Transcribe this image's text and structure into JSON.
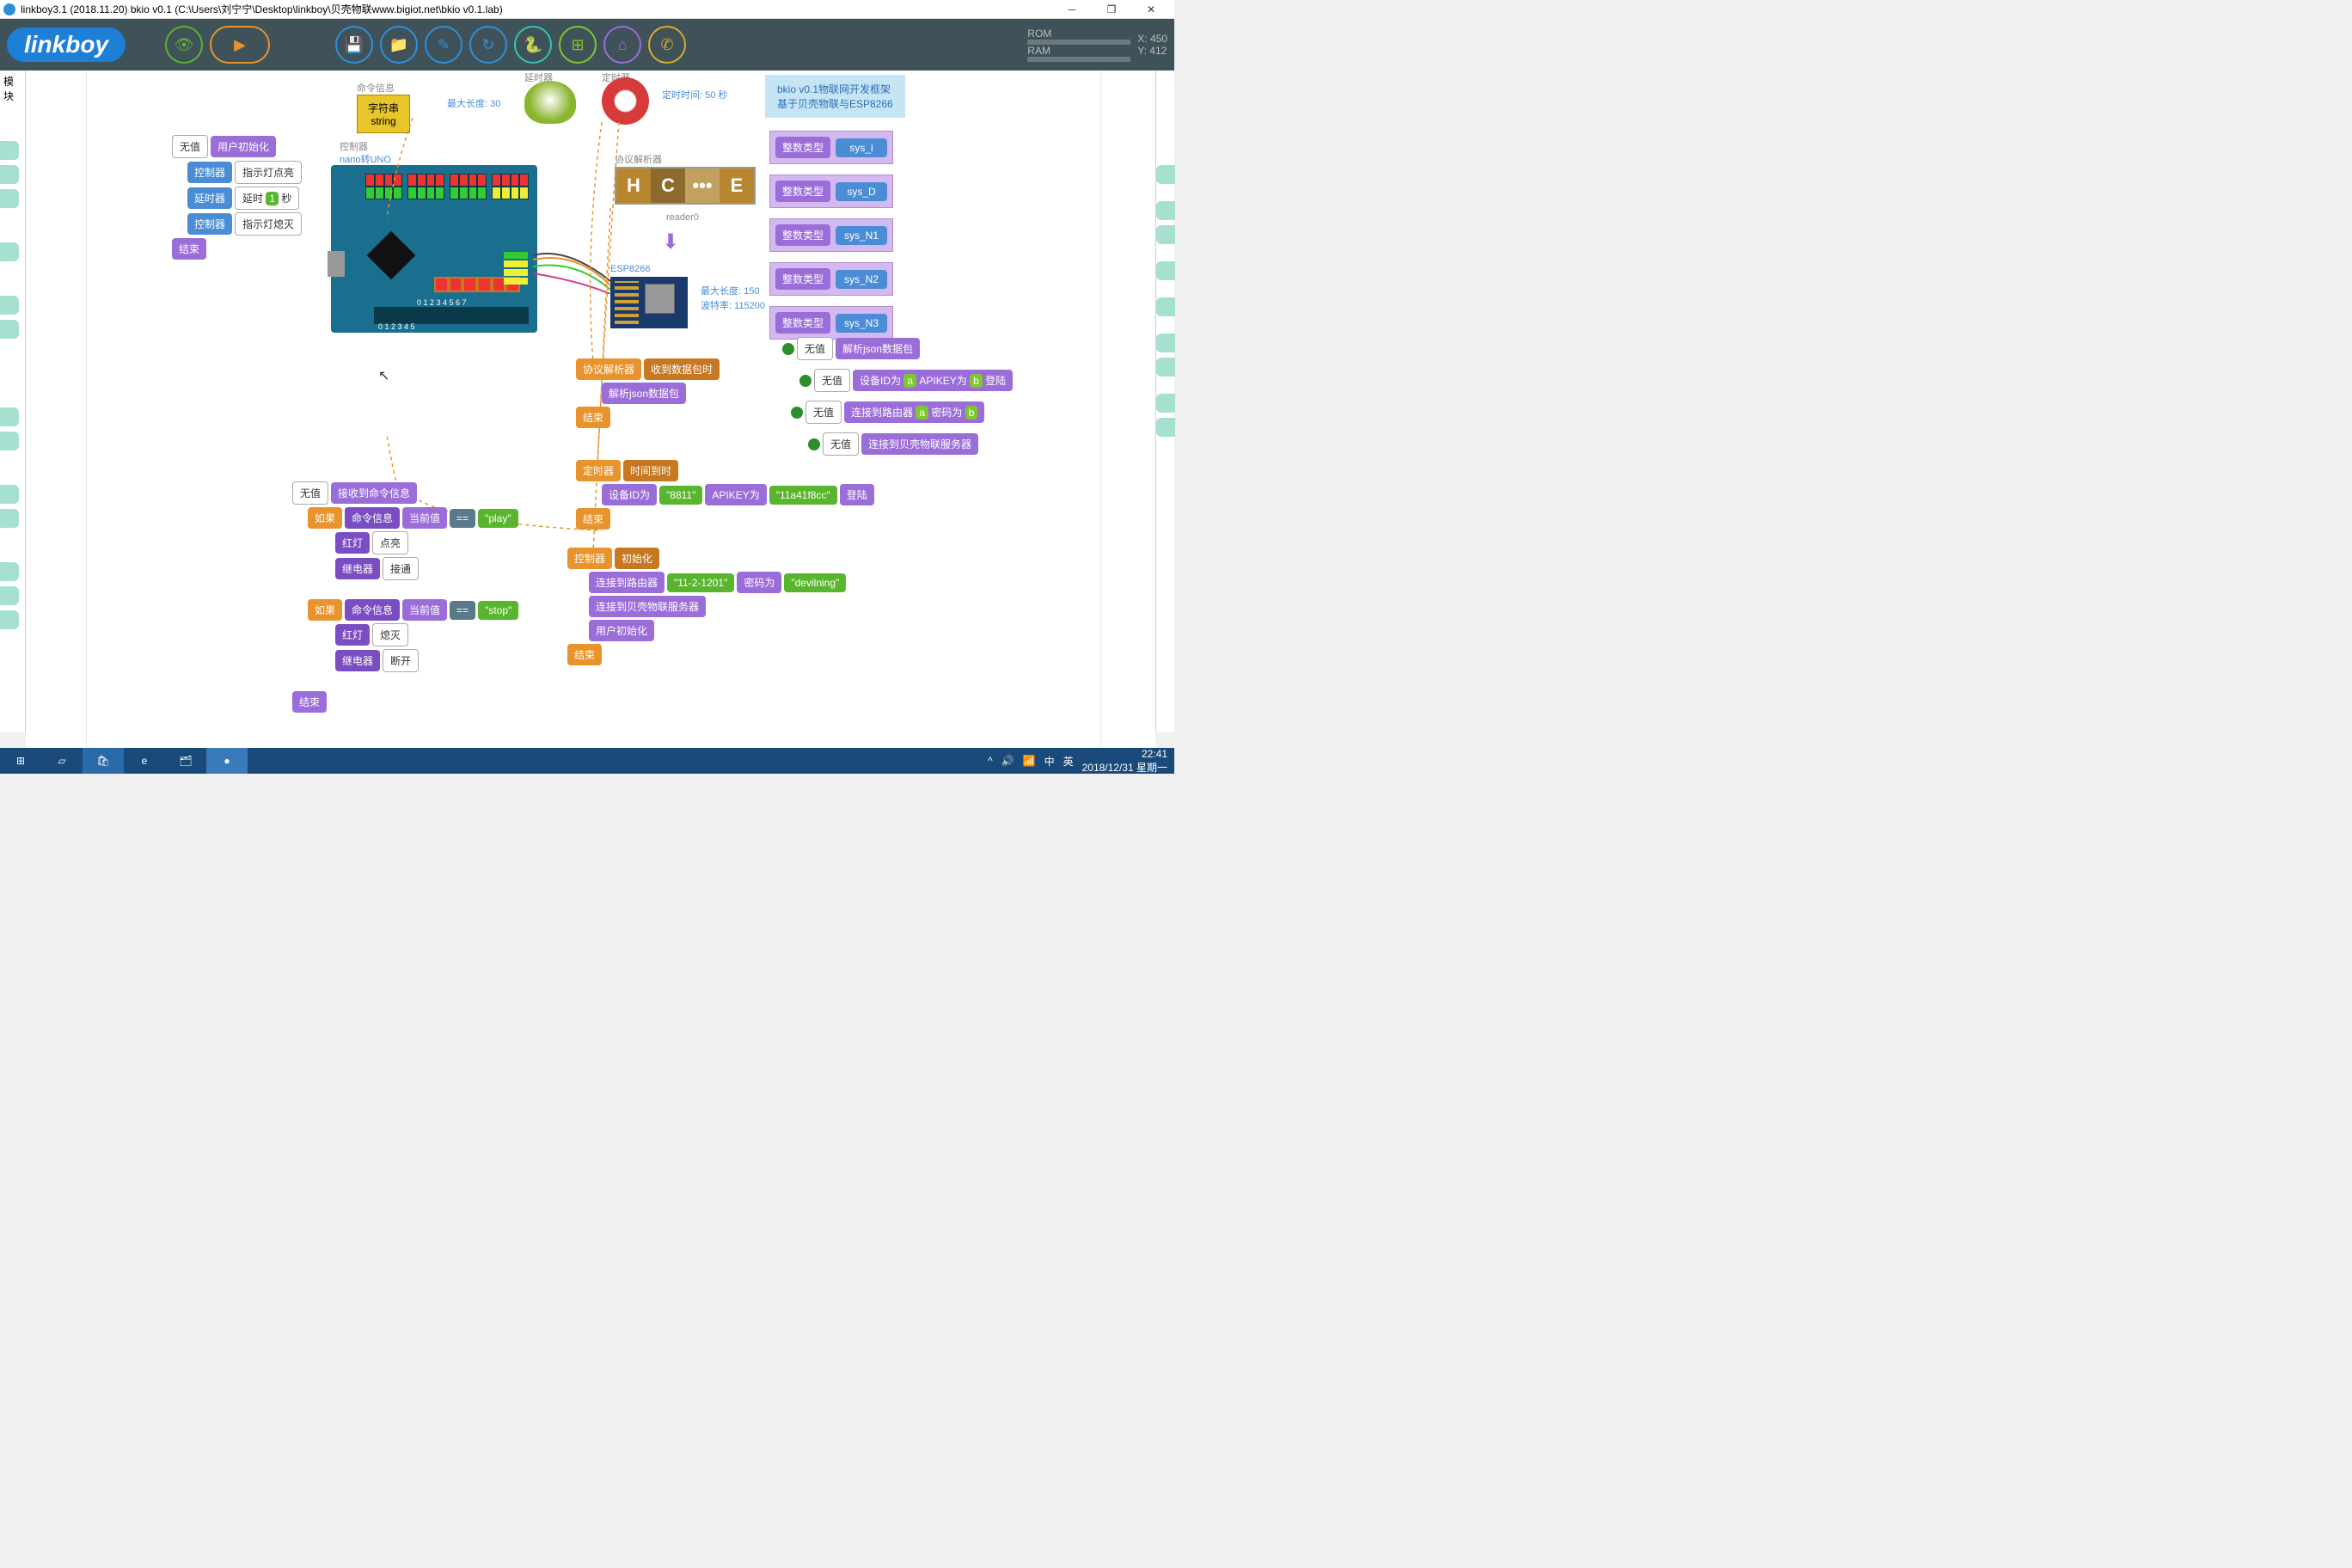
{
  "window": {
    "title": "linkboy3.1 (2018.11.20) bkio v0.1 (C:\\Users\\刘宁宁\\Desktop\\linkboy\\贝壳物联www.bigiot.net\\bkio v0.1.lab)",
    "minimize": "─",
    "maximize": "❐",
    "close": "✕"
  },
  "logo": "linkboy",
  "status": {
    "rom": "ROM",
    "ram": "RAM",
    "x": "X: 450",
    "y": "Y: 412"
  },
  "leftTab": "模块",
  "labels": {
    "cmdinfo": "命令信息",
    "string1": "字符串",
    "string2": "string",
    "maxlen30": "最大长度: 30",
    "timer1": "延时器",
    "timer2": "定时器",
    "timefix": "定时时间: 50 秒",
    "controller": "控制器",
    "nano": "nano转UNO",
    "parser": "协议解析器",
    "reader": "reader0",
    "esp": "ESP8266",
    "maxlen150": "最大长度: 150",
    "baud": "波特率: 115200",
    "bkio1": "bkio  v0.1物联网开发框架",
    "bkio2": "基于贝壳物联与ESP8266",
    "intType": "整数类型"
  },
  "vars": {
    "sysi": "sys_i",
    "sysd": "sys_D",
    "sysn1": "sys_N1",
    "sysn2": "sys_N2",
    "sysn3": "sys_N3"
  },
  "blocks": {
    "novalue": "无值",
    "userinit": "用户初始化",
    "ctrl": "控制器",
    "ledon": "指示灯点亮",
    "delay": "延时器",
    "delayact": "延时",
    "sec": "秒",
    "one": "1",
    "ledoff": "指示灯熄灭",
    "end": "结束",
    "recvcmd": "接收到命令信息",
    "if": "如果",
    "cmdcur": "命令信息",
    "curval": "当前值",
    "eq": "==",
    "play": "\"play\"",
    "stop": "\"stop\"",
    "redled": "红灯",
    "lighton": "点亮",
    "lightoff": "熄灭",
    "relay": "继电器",
    "conn": "接通",
    "disc": "断开",
    "parser2": "协议解析器",
    "onpkt": "收到数据包时",
    "parsejson": "解析json数据包",
    "timer": "定时器",
    "ontime": "时间到时",
    "devid": "设备ID为",
    "id8811": "\"8811\"",
    "apikey": "APIKEY为",
    "key": "\"11a41f8cc\"",
    "login": "登陆",
    "ctrlinit": "控制器",
    "init": "初始化",
    "connrouter": "连接到路由器",
    "ssid": "\"11-2-1201\"",
    "pwd": "密码为",
    "pwdval": "\"devilning\"",
    "connbk": "连接到贝壳物联服务器",
    "userinit2": "用户初始化",
    "a": "a",
    "b": "b"
  },
  "parserLetters": {
    "h": "H",
    "c": "C",
    "dots": "•••",
    "e": "E"
  },
  "taskbar": {
    "ime1": "中",
    "ime2": "英",
    "caret": "^",
    "time": "22:41",
    "date": "2018/12/31 星期一"
  }
}
